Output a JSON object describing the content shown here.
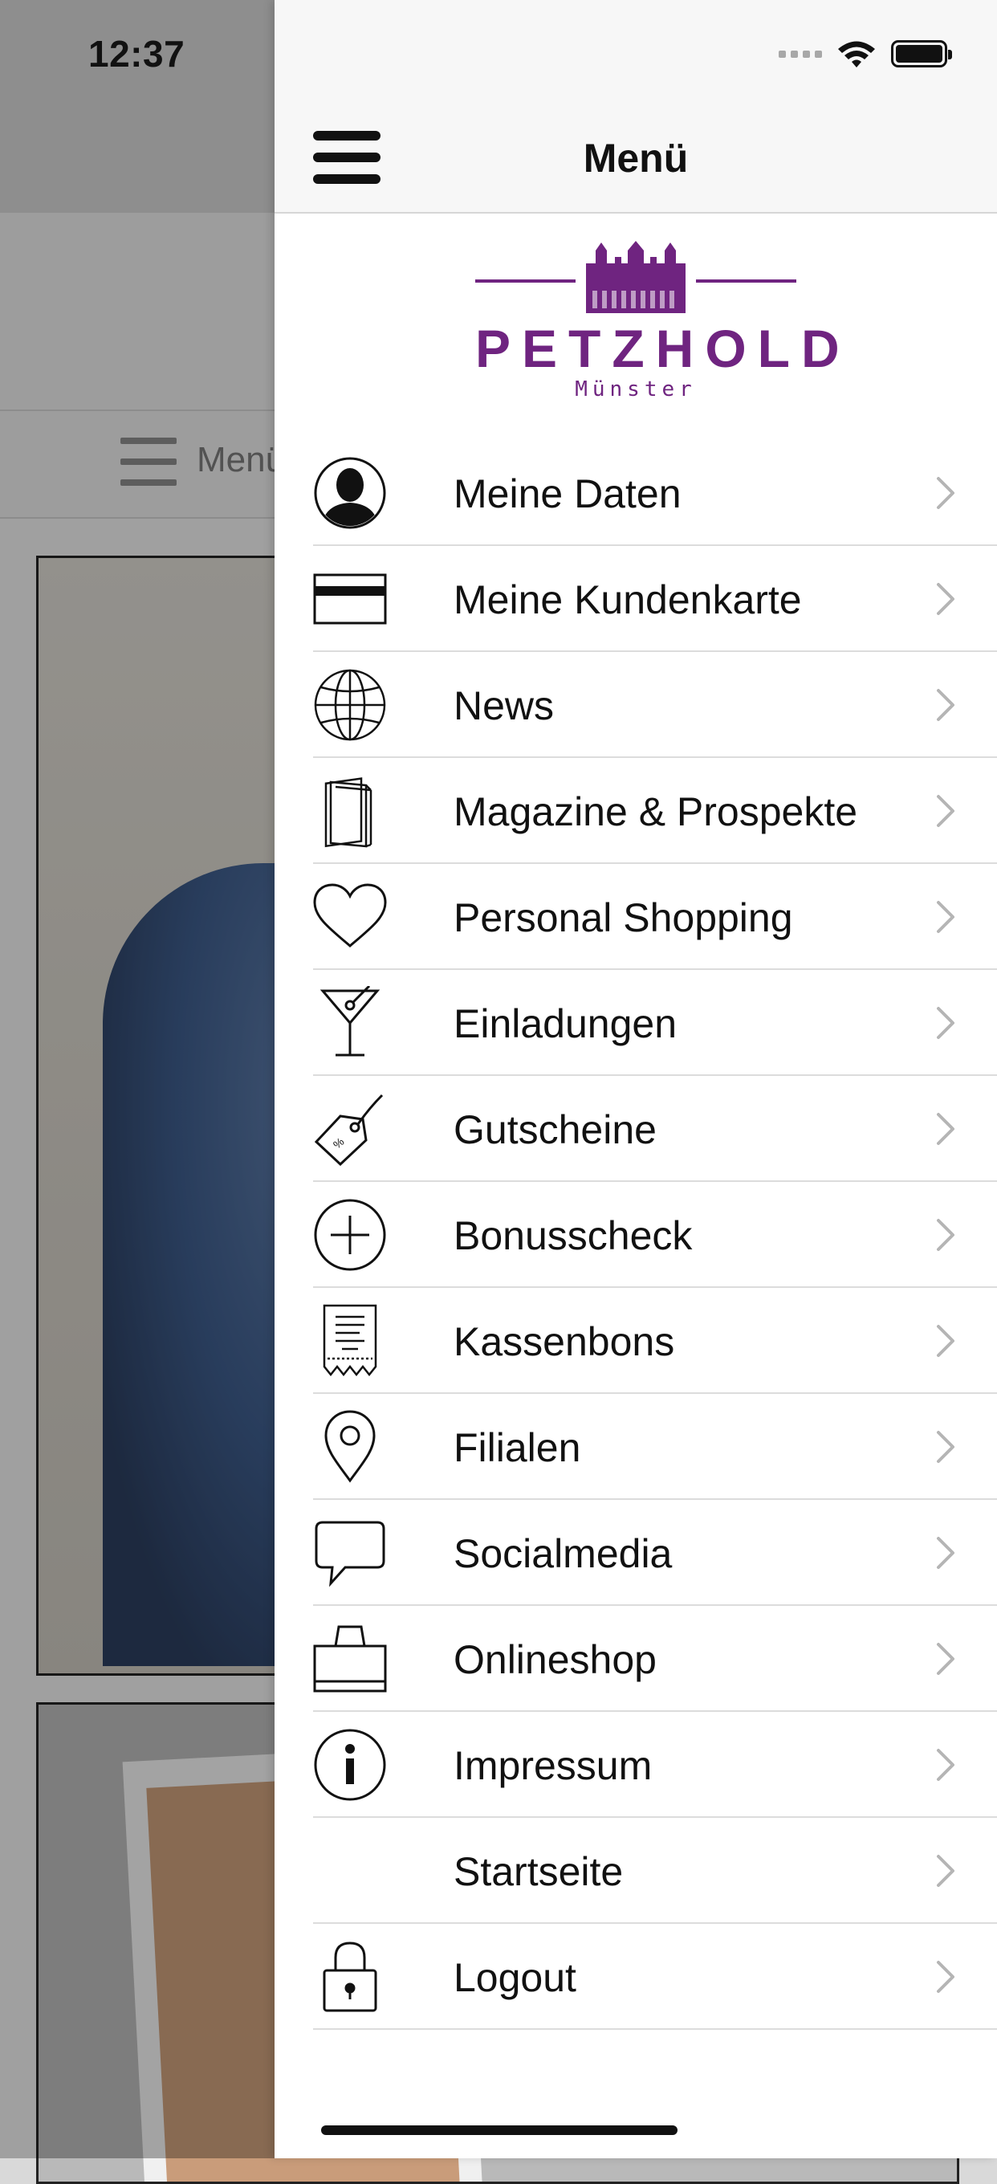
{
  "status_bar": {
    "time": "12:37"
  },
  "background": {
    "menu_label": "Menü"
  },
  "drawer": {
    "title": "Menü",
    "logo": {
      "brand": "PETZHOLD",
      "city": "Münster"
    },
    "items": [
      {
        "label": "Meine Daten",
        "icon": "person-icon"
      },
      {
        "label": "Meine Kundenkarte",
        "icon": "card-icon"
      },
      {
        "label": "News",
        "icon": "globe-icon"
      },
      {
        "label": "Magazine & Prospekte",
        "icon": "magazine-icon"
      },
      {
        "label": "Personal Shopping",
        "icon": "heart-icon"
      },
      {
        "label": "Einladungen",
        "icon": "cocktail-icon"
      },
      {
        "label": "Gutscheine",
        "icon": "tag-icon"
      },
      {
        "label": "Bonusscheck",
        "icon": "plus-circle-icon"
      },
      {
        "label": "Kassenbons",
        "icon": "receipt-icon"
      },
      {
        "label": "Filialen",
        "icon": "location-pin-icon"
      },
      {
        "label": "Socialmedia",
        "icon": "speech-bubble-icon"
      },
      {
        "label": "Onlineshop",
        "icon": "shopping-bag-icon"
      },
      {
        "label": "Impressum",
        "icon": "info-icon"
      },
      {
        "label": "Startseite",
        "icon": ""
      },
      {
        "label": "Logout",
        "icon": "lock-icon"
      }
    ]
  },
  "colors": {
    "brand": "#6f2480",
    "divider": "#dcdcdc",
    "chevron": "#b5b5b5",
    "overlay": "rgba(0,0,0,0.32)"
  }
}
